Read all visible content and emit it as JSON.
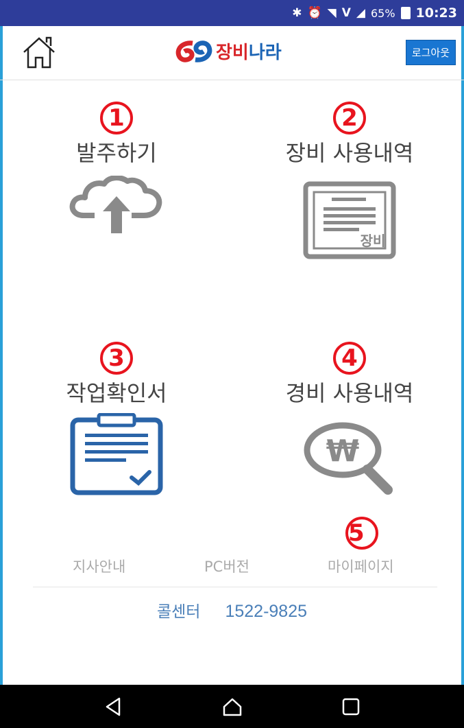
{
  "status_bar": {
    "icons": [
      "bluetooth-icon",
      "alarm-icon",
      "wifi-icon",
      "volte-icon",
      "signal-icon"
    ],
    "volte_label": "V",
    "battery": "65%",
    "time": "10:23"
  },
  "header": {
    "logo_text_red": "장비",
    "logo_text_blue": "나라",
    "logout_label": "로그아웃"
  },
  "menu": [
    {
      "number": "1",
      "label": "발주하기",
      "icon": "cloud-upload-icon"
    },
    {
      "number": "2",
      "label": "장비 사용내역",
      "icon": "equipment-document-icon",
      "icon_text": "장비"
    },
    {
      "number": "3",
      "label": "작업확인서",
      "icon": "clipboard-check-icon"
    },
    {
      "number": "4",
      "label": "경비 사용내역",
      "icon": "won-magnifier-icon",
      "icon_text": "₩"
    }
  ],
  "footer": {
    "marker_number": "5",
    "links": [
      "지사안내",
      "PC버전",
      "마이페이지"
    ],
    "callcenter_label": "콜센터",
    "callcenter_phone": "1522-9825"
  },
  "colors": {
    "statusbar": "#2e3d9a",
    "accent_red": "#e8141e",
    "logout_blue": "#1976d2",
    "icon_gray": "#8a8a8a",
    "clipboard_blue": "#2a64a8"
  }
}
